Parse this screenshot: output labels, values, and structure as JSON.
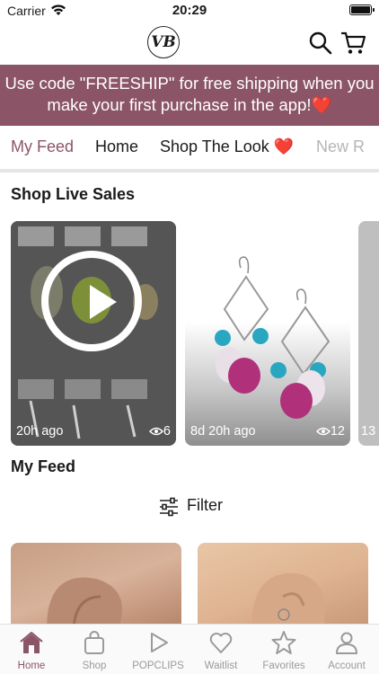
{
  "status_bar": {
    "carrier": "Carrier",
    "time": "20:29"
  },
  "header": {
    "logo_text": "VB"
  },
  "promo_banner": {
    "text": "Use code \"FREESHIP\" for free shipping when you make your first purchase in the app!❤️"
  },
  "tabs": [
    {
      "label": "My Feed",
      "active": true
    },
    {
      "label": "Home"
    },
    {
      "label": "Shop The Look ❤️"
    },
    {
      "label": "New R"
    }
  ],
  "live_sales": {
    "title": "Shop Live Sales",
    "cards": [
      {
        "time": "20h ago",
        "views": "6"
      },
      {
        "time": "8d 20h ago",
        "views": "12"
      },
      {
        "time": "13"
      }
    ]
  },
  "feed": {
    "title": "My Feed",
    "filter_label": "Filter"
  },
  "bottom_tabs": [
    {
      "label": "Home",
      "icon": "home-icon",
      "active": true
    },
    {
      "label": "Shop",
      "icon": "bag-icon"
    },
    {
      "label": "POPCLIPS",
      "icon": "play-icon"
    },
    {
      "label": "Waitlist",
      "icon": "heart-icon"
    },
    {
      "label": "Favorites",
      "icon": "star-icon"
    },
    {
      "label": "Account",
      "icon": "person-icon"
    }
  ],
  "colors": {
    "accent": "#8b5567",
    "inactive": "#9a9a9a"
  }
}
